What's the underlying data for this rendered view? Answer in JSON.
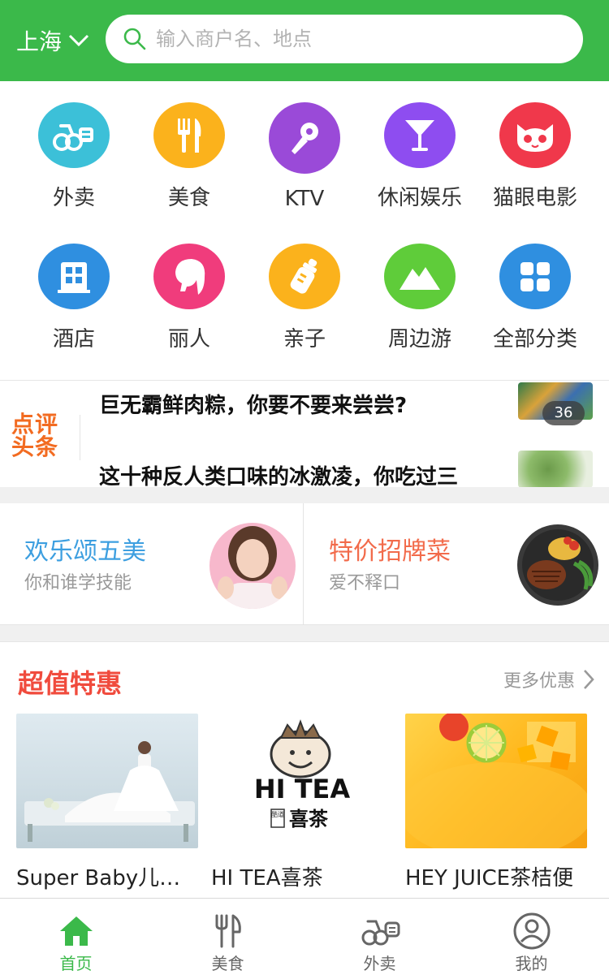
{
  "header": {
    "city": "上海",
    "search_placeholder": "输入商户名、地点",
    "bg_color": "#3bb94a"
  },
  "categories": [
    {
      "label": "外卖",
      "icon": "takeaway-scooter-icon",
      "color": "#3cc0d8"
    },
    {
      "label": "美食",
      "icon": "fork-knife-icon",
      "color": "#fbb21c"
    },
    {
      "label": "KTV",
      "icon": "microphone-icon",
      "color": "#9a4ad8"
    },
    {
      "label": "休闲娱乐",
      "icon": "cocktail-icon",
      "color": "#8e4df0"
    },
    {
      "label": "猫眼电影",
      "icon": "cat-face-icon",
      "color": "#f0384b"
    },
    {
      "label": "酒店",
      "icon": "hotel-building-icon",
      "color": "#2f8fe0"
    },
    {
      "label": "丽人",
      "icon": "woman-profile-icon",
      "color": "#f03c7c"
    },
    {
      "label": "亲子",
      "icon": "baby-bottle-icon",
      "color": "#fbb21c"
    },
    {
      "label": "周边游",
      "icon": "mountain-icon",
      "color": "#5fcc3a"
    },
    {
      "label": "全部分类",
      "icon": "all-categories-icon",
      "color": "#2f8fe0"
    }
  ],
  "headlines": {
    "logo_line1": "点评",
    "logo_line2": "头条",
    "items": [
      "巨无霸鲜肉粽，你要不要来尝尝?",
      "这十种反人类口味的冰激凌，你吃过三"
    ],
    "badge": "36"
  },
  "promos": [
    {
      "title": "欢乐颂五美",
      "subtitle": "你和谁学技能",
      "color": "#3d9fe0"
    },
    {
      "title": "特价招牌菜",
      "subtitle": "爱不释口",
      "color": "#f26b4b"
    }
  ],
  "deals": {
    "title": "超值特惠",
    "more": "更多优惠",
    "items": [
      {
        "name": "Super Baby儿童摄影"
      },
      {
        "name": "HI TEA喜茶",
        "logo_text": "HI TEA",
        "logo_sub": "喜茶",
        "logo_seal": "酷道"
      },
      {
        "name": "HEY JUICE茶桔便"
      }
    ]
  },
  "tabbar": [
    {
      "label": "首页",
      "icon": "home-icon",
      "active": true
    },
    {
      "label": "美食",
      "icon": "fork-knife-icon",
      "active": false
    },
    {
      "label": "外卖",
      "icon": "takeaway-scooter-icon",
      "active": false
    },
    {
      "label": "我的",
      "icon": "user-profile-icon",
      "active": false
    }
  ],
  "colors": {
    "accent": "#3bb94a",
    "deal_title": "#f04b3d",
    "headline_logo": "#f26b21"
  }
}
